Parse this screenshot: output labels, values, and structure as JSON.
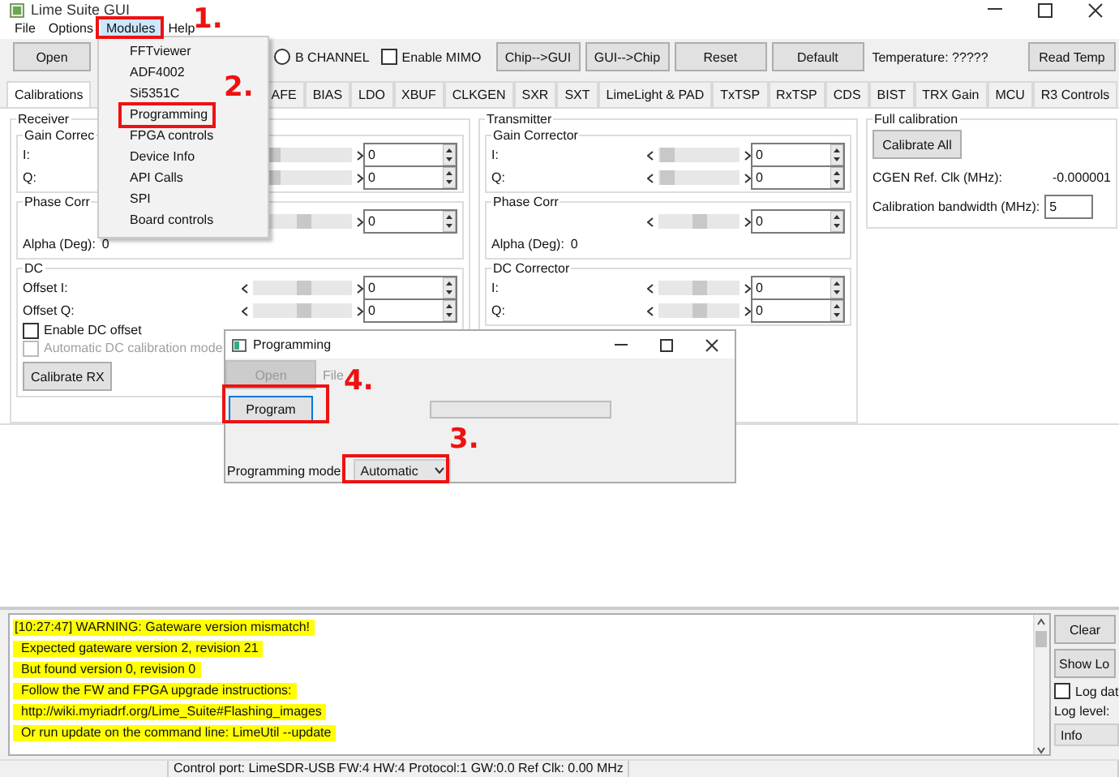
{
  "window": {
    "title": "Lime Suite GUI"
  },
  "menu_bar": [
    {
      "label": "File",
      "selected": false
    },
    {
      "label": "Options",
      "selected": false
    },
    {
      "label": "Modules",
      "selected": true
    },
    {
      "label": "Help",
      "selected": false
    }
  ],
  "toolbar": {
    "open": "Open",
    "channel_b": {
      "label": "B CHANNEL",
      "selected": false
    },
    "mimo": {
      "label": "Enable MIMO",
      "checked": false
    },
    "buttons": [
      "Chip-->GUI",
      "GUI-->Chip",
      "Reset",
      "Default"
    ],
    "temperature": "Temperature: ?????",
    "read_temp": "Read Temp"
  },
  "tabs": [
    {
      "label": "Calibrations",
      "selected": true
    },
    {
      "label": "AFE",
      "selected": false
    },
    {
      "label": "BIAS",
      "selected": false
    },
    {
      "label": "LDO",
      "selected": false
    },
    {
      "label": "XBUF",
      "selected": false
    },
    {
      "label": "CLKGEN",
      "selected": false
    },
    {
      "label": "SXR",
      "selected": false
    },
    {
      "label": "SXT",
      "selected": false
    },
    {
      "label": "LimeLight & PAD",
      "selected": false
    },
    {
      "label": "TxTSP",
      "selected": false
    },
    {
      "label": "RxTSP",
      "selected": false
    },
    {
      "label": "CDS",
      "selected": false
    },
    {
      "label": "BIST",
      "selected": false
    },
    {
      "label": "TRX Gain",
      "selected": false
    },
    {
      "label": "MCU",
      "selected": false
    },
    {
      "label": "R3 Controls",
      "selected": false
    }
  ],
  "receiver": {
    "title": "Receiver",
    "gain_corrector": {
      "title": "Gain Correc",
      "rows": [
        {
          "label": "I:",
          "level": 0.2,
          "value": "0"
        },
        {
          "label": "Q:",
          "level": 0.2,
          "value": "0"
        }
      ]
    },
    "phase_corr": {
      "title": "Phase Corr",
      "slider": {
        "level": 0.5,
        "value": "0"
      },
      "alpha_label": "Alpha (Deg):",
      "alpha_value": "0"
    },
    "dc": {
      "title": "DC",
      "rows": [
        {
          "label": "Offset I:",
          "level": 0.5,
          "value": "0"
        },
        {
          "label": "Offset Q:",
          "level": 0.5,
          "value": "0"
        }
      ],
      "checks": [
        {
          "label": "Enable DC offset",
          "checked": false,
          "disabled": false
        },
        {
          "label": "Automatic DC calibration mode",
          "checked": false,
          "disabled": true
        }
      ],
      "button": "Calibrate RX"
    }
  },
  "transmitter": {
    "title": "Transmitter",
    "gain_corrector": {
      "title": "Gain Corrector",
      "rows": [
        {
          "label": "I:",
          "level": 0.1,
          "value": "0"
        },
        {
          "label": "Q:",
          "level": 0.1,
          "value": "0"
        }
      ]
    },
    "phase_corr": {
      "title": "Phase Corr",
      "slider": {
        "level": 0.5,
        "value": "0"
      },
      "alpha_label": "Alpha (Deg):",
      "alpha_value": "0"
    },
    "dc": {
      "title": "DC Corrector",
      "rows": [
        {
          "label": "I:",
          "level": 0.5,
          "value": "0"
        },
        {
          "label": "Q:",
          "level": 0.5,
          "value": "0"
        }
      ]
    }
  },
  "full_calibration": {
    "title": "Full calibration",
    "button": "Calibrate All",
    "fields": [
      {
        "kind": "readout",
        "label": "CGEN Ref. Clk (MHz):",
        "value": "-0.000001"
      },
      {
        "kind": "input",
        "label": "Calibration bandwidth (MHz):",
        "value": "5"
      }
    ]
  },
  "modules_menu": {
    "items": [
      "FFTviewer",
      "ADF4002",
      "Si5351C",
      "Programming",
      "FPGA controls",
      "Device Info",
      "API Calls",
      "SPI",
      "Board controls"
    ]
  },
  "programming_dialog": {
    "title": "Programming",
    "open_button": {
      "label": "Open",
      "disabled": true
    },
    "file_label": "File",
    "progress": {
      "level": 0
    },
    "program_button": "Program",
    "mode_label": "Programming mode",
    "mode_value": "Automatic"
  },
  "log": {
    "lines": [
      "[10:27:47] WARNING: Gateware version mismatch!",
      "Expected gateware version 2, revision 21",
      "But found version 0, revision 0",
      "Follow the FW and FPGA upgrade instructions:",
      "http://wiki.myriadrf.org/Lime_Suite#Flashing_images",
      "Or run update on the command line: LimeUtil --update"
    ]
  },
  "log_controls": {
    "clear": "Clear",
    "show_log": "Show Lo",
    "log_data": {
      "label": "Log dat",
      "checked": false
    },
    "log_level_label": "Log level:",
    "log_level": "Info"
  },
  "status_bar": "Control port: LimeSDR-USB FW:4 HW:4 Protocol:1 GW:0.0 Ref Clk: 0.00 MHz",
  "annotations": [
    {
      "label": "1."
    },
    {
      "label": "2."
    },
    {
      "label": "3."
    },
    {
      "label": "4."
    }
  ]
}
